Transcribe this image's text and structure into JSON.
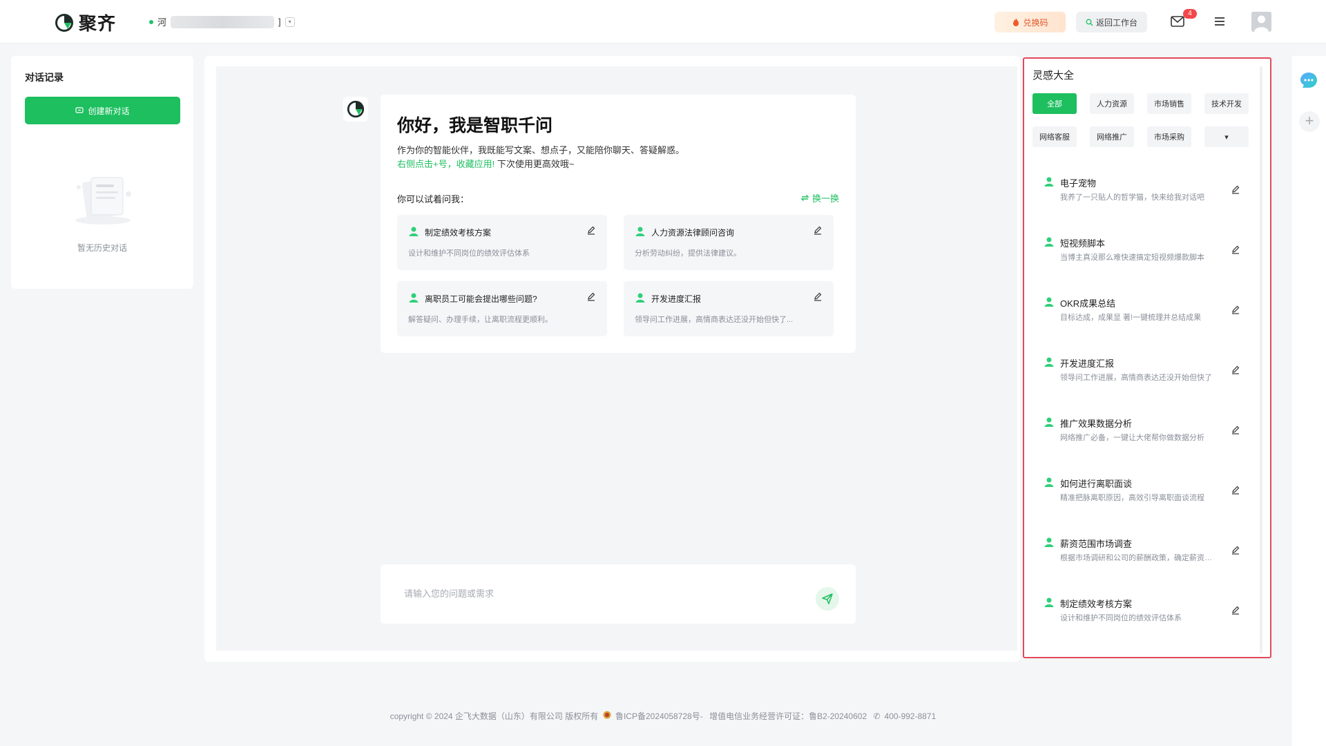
{
  "brand": {
    "name": "聚齐"
  },
  "org": {
    "name": "河",
    "tail": "]"
  },
  "header": {
    "redeem_label": "兑换码",
    "back_label": "返回工作台",
    "mail_badge": "4"
  },
  "sidebar": {
    "title": "对话记录",
    "new_chat_label": "创建新对话",
    "empty_text": "暂无历史对话"
  },
  "welcome": {
    "title": "你好，我是智职千问",
    "desc": "作为你的智能伙伴，我既能写文案、想点子，又能陪你聊天、答疑解惑。",
    "tip_green": "右侧点击+号，收藏应用!",
    "tip_rest": " 下次使用更高效哦~",
    "try_label": "你可以试着问我：",
    "refresh_label": "换一换",
    "questions": [
      {
        "title": "制定绩效考核方案",
        "sub": "设计和维护不同岗位的绩效评估体系"
      },
      {
        "title": "人力资源法律顾问咨询",
        "sub": "分析劳动纠纷，提供法律建议。"
      },
      {
        "title": "离职员工可能会提出哪些问题?",
        "sub": "解答疑问、办理手续，让离职流程更顺利。"
      },
      {
        "title": "开发进度汇报",
        "sub": "领导问工作进展，高情商表达还没开始但快了..."
      }
    ]
  },
  "input": {
    "placeholder": "请输入您的问题或需求"
  },
  "inspiration": {
    "title": "灵感大全",
    "categories": [
      "全部",
      "人力资源",
      "市场销售",
      "技术开发",
      "网络客服",
      "网络推广",
      "市场采购"
    ],
    "more_icon": "▾",
    "items": [
      {
        "title": "电子宠物",
        "sub": "我养了一只贴人的哲学猫，快来给我对话吧"
      },
      {
        "title": "短视频脚本",
        "sub": "当博主真没那么难快速搞定短视频爆款脚本"
      },
      {
        "title": "OKR成果总结",
        "sub": "目标达成，成果显 著!一键梳理并总结成果"
      },
      {
        "title": "开发进度汇报",
        "sub": "领导问工作进展，高情商表达还没开始但快了"
      },
      {
        "title": "推广效果数据分析",
        "sub": "网络推广必备，一键让大佬帮你做数据分析"
      },
      {
        "title": "如何进行离职面谈",
        "sub": "精准把脉离职原因，高效引导离职面谈流程"
      },
      {
        "title": "薪资范围市场调查",
        "sub": "根据市场调研和公司的薪酬政策，确定薪资范围"
      },
      {
        "title": "制定绩效考核方案",
        "sub": "设计和维护不同岗位的绩效评估体系"
      }
    ]
  },
  "footer": {
    "copyright": "copyright © 2024 企飞大数据（山东）有限公司 版权所有",
    "icp": "鲁ICP备2024058728号-",
    "license": "增值电信业务经营许可证：鲁B2-20240602",
    "phone": "400-992-8871"
  },
  "colors": {
    "accent": "#1dbf5f",
    "highlight_border": "#e4475c",
    "badge": "#f2474b"
  }
}
